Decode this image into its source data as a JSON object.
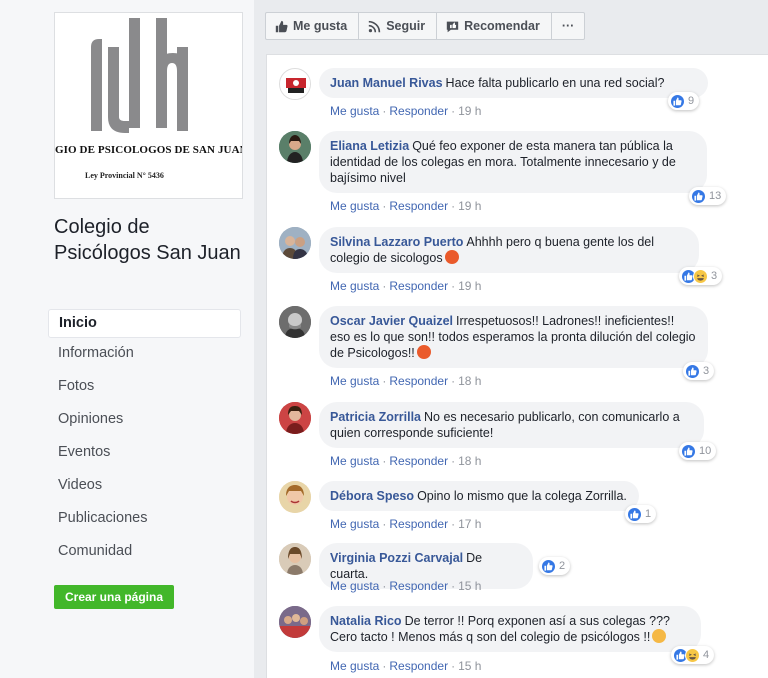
{
  "page": {
    "title": "Colegio de Psicólogos San Juan",
    "logo": {
      "name": "GIO DE PSICOLOGOS DE SAN JUAN",
      "law": "Ley Provincial  N° 5436"
    }
  },
  "nav": {
    "items": [
      {
        "label": "Inicio",
        "active": true
      },
      {
        "label": "Información"
      },
      {
        "label": "Fotos"
      },
      {
        "label": "Opiniones"
      },
      {
        "label": "Eventos"
      },
      {
        "label": "Videos"
      },
      {
        "label": "Publicaciones"
      },
      {
        "label": "Comunidad"
      }
    ],
    "create_page": "Crear una página"
  },
  "actions": {
    "like": "Me gusta",
    "follow": "Seguir",
    "recommend": "Recomendar",
    "more": "···"
  },
  "comment_meta": {
    "like": "Me gusta",
    "reply": "Responder",
    "sep": "·"
  },
  "comments": [
    {
      "author": "Juan Manuel Rivas",
      "text": "Hace falta publicarlo en una red social?",
      "time": "19 h",
      "reactions": "9",
      "reaction_types": [
        "like"
      ]
    },
    {
      "author": "Eliana Letizia",
      "text": "Qué feo exponer de esta manera tan pública la identidad de los colegas en mora. Totalmente innecesario y de bajísimo nivel",
      "time": "19 h",
      "reactions": "13",
      "reaction_types": [
        "like"
      ]
    },
    {
      "author": "Silvina Lazzaro Puerto",
      "text": "Ahhhh pero q buena gente los del colegio de sicologos",
      "time": "19 h",
      "reactions": "3",
      "reaction_types": [
        "like",
        "haha"
      ],
      "emoji": "angry-face"
    },
    {
      "author": "Oscar Javier Quaizel",
      "text": "Irrespetuosos!! Ladrones!! ineficientes!! eso es lo que son!! todos esperamos la pronta dilución del colegio de Psicologos!!",
      "time": "18 h",
      "reactions": "3",
      "reaction_types": [
        "like"
      ],
      "emoji": "angry-face"
    },
    {
      "author": "Patricia Zorrilla",
      "text": "No es necesario publicarlo, con comunicarlo a quien corresponde suficiente!",
      "time": "18 h",
      "reactions": "10",
      "reaction_types": [
        "like"
      ]
    },
    {
      "author": "Débora Speso",
      "text": "Opino lo mismo que la colega Zorrilla.",
      "time": "17 h",
      "reactions": "1",
      "reaction_types": [
        "like"
      ]
    },
    {
      "author": "Virginia Pozzi Carvajal",
      "text": "De cuarta.",
      "time": "15 h",
      "reactions": "2",
      "reaction_types": [
        "like"
      ]
    },
    {
      "author": "Natalia Rico",
      "text": "De terror !! Porq exponen así a sus colegas ??? Cero tacto ! Menos más q son del colegio de psicólogos !!",
      "time": "15 h",
      "reactions": "4",
      "reaction_types": [
        "like",
        "haha"
      ],
      "emoji": "woman-shrugging"
    }
  ],
  "colors": {
    "link": "#385898",
    "like_blue": "#3578e5",
    "haha_yellow": "#f7c746",
    "create_green": "#42b72a"
  }
}
